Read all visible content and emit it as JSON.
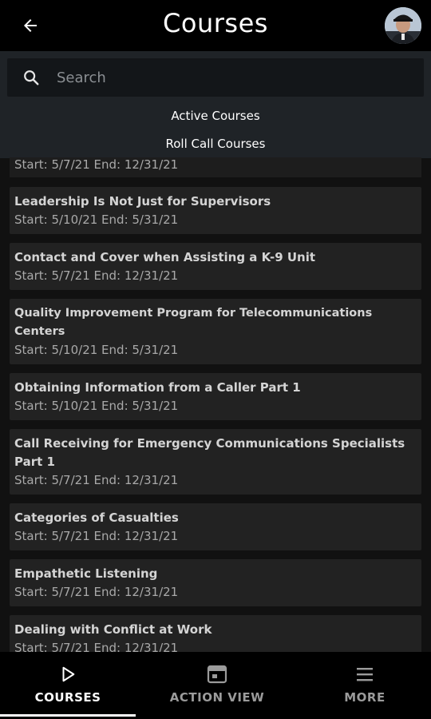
{
  "header": {
    "title": "Courses",
    "back_icon": "arrow-left-icon",
    "avatar_icon": "user-avatar"
  },
  "search": {
    "placeholder": "Search",
    "icon": "search-icon"
  },
  "filters": {
    "active_label": "Active Courses",
    "rollcall_label": "Roll Call Courses"
  },
  "partial_row": {
    "dates": "Start: 5/7/21 End: 12/31/21"
  },
  "courses": [
    {
      "title": "Leadership Is Not Just for Supervisors",
      "dates": "Start: 5/10/21 End: 5/31/21"
    },
    {
      "title": "Contact and Cover when Assisting a K-9 Unit",
      "dates": "Start: 5/7/21 End: 12/31/21"
    },
    {
      "title": "Quality Improvement Program for Telecommunications Centers",
      "dates": "Start: 5/10/21 End: 5/31/21"
    },
    {
      "title": "Obtaining Information from a Caller Part 1",
      "dates": "Start: 5/10/21 End: 5/31/21"
    },
    {
      "title": "Call Receiving for Emergency Communications Specialists Part 1",
      "dates": "Start: 5/7/21 End: 12/31/21"
    },
    {
      "title": "Categories of Casualties",
      "dates": "Start: 5/7/21 End: 12/31/21"
    },
    {
      "title": "Empathetic Listening",
      "dates": "Start: 5/7/21 End: 12/31/21"
    },
    {
      "title": "Dealing with Conflict at Work",
      "dates": "Start: 5/7/21 End: 12/31/21"
    }
  ],
  "nav": {
    "courses_label": "COURSES",
    "action_label": "ACTION VIEW",
    "more_label": "MORE",
    "courses_icon": "play-icon",
    "action_icon": "calendar-window-icon",
    "more_icon": "hamburger-menu-icon",
    "active_tab": "COURSES"
  },
  "colors": {
    "background": "#111111",
    "card": "#222222",
    "header": "#000000",
    "search_panel": "#1f2327",
    "active_text": "#ffffff",
    "inactive_text": "#9b9b9b"
  }
}
